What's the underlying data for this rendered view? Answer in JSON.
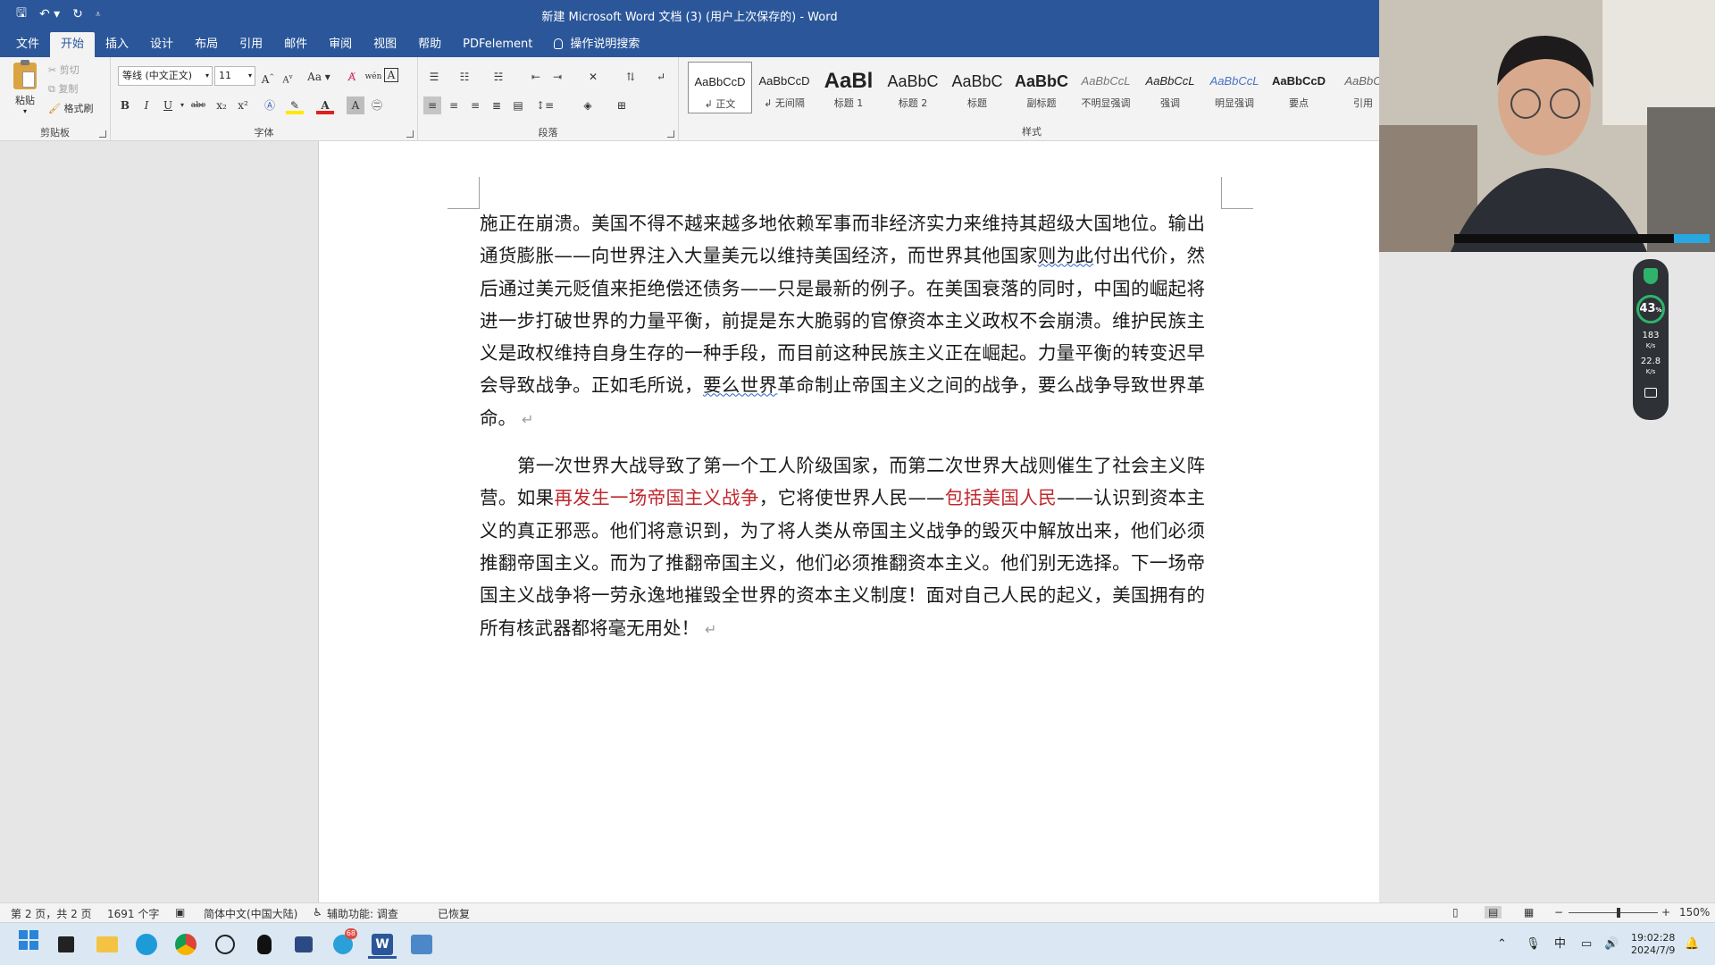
{
  "window": {
    "title": "新建 Microsoft Word 文档 (3) (用户上次保存的)  -  Word"
  },
  "tabs": [
    "文件",
    "开始",
    "插入",
    "设计",
    "布局",
    "引用",
    "邮件",
    "审阅",
    "视图",
    "帮助",
    "PDFelement",
    "操作说明搜索"
  ],
  "active_tab": "开始",
  "clipboard": {
    "paste": "粘贴",
    "cut": "剪切",
    "copy": "复制",
    "format_painter": "格式刷",
    "label": "剪贴板"
  },
  "font": {
    "name": "等线 (中文正文)",
    "size": "11",
    "grow": "A",
    "shrink": "A",
    "case": "Aa",
    "bold": "B",
    "italic": "I",
    "underline": "U",
    "strike": "abc",
    "sub": "x₂",
    "sup": "x²",
    "label": "字体"
  },
  "paragraph": {
    "label": "段落"
  },
  "styles": {
    "label": "样式",
    "items": [
      {
        "preview": "AaBbCcD",
        "name": "↲ 正文"
      },
      {
        "preview": "AaBbCcD",
        "name": "↲ 无间隔"
      },
      {
        "preview": "AaBl",
        "name": "标题 1"
      },
      {
        "preview": "AaBbC",
        "name": "标题 2"
      },
      {
        "preview": "AaBbC",
        "name": "标题"
      },
      {
        "preview": "AaBbC",
        "name": "副标题"
      },
      {
        "preview": "AaBbCcL",
        "name": "不明显强调"
      },
      {
        "preview": "AaBbCcL",
        "name": "强调"
      },
      {
        "preview": "AaBbCcL",
        "name": "明显强调"
      },
      {
        "preview": "AaBbCcD",
        "name": "要点"
      },
      {
        "preview": "AaBbC",
        "name": "引用"
      }
    ]
  },
  "document": {
    "p1": {
      "a": "施正在崩溃。美国不得不越来越多地依赖军事而非经济实力来维持其超级大国地位。输出通货膨胀——向世界注入大量美元以维持美国经济，而世界其他国家",
      "b": "则为此",
      "c": "付出代价，然后通过美元贬值来拒绝偿还债务——只是最新的例子。在美国衰落的同时，中国的崛起将进一步打破世界的力量平衡，前提是东大脆弱的官僚资本主义政权不会崩溃。维护民族主义是政权维持自身生存的一种手段，而目前这种民族主义正在崛起。力量平衡的转变迟早会导致战争。正如毛所说，",
      "d": "要么世界",
      "e": "革命制止帝国主义之间的战争，要么战争导致世界革命。"
    },
    "p2": {
      "a": "第一次世界大战导致了第一个工人阶级国家，而第二次世界大战则催生了社会主义阵营。如果",
      "b": "再发生一场帝国主义战争",
      "c": "，它将使世界人民——",
      "d": "包括美国人民",
      "e": "——认识到资本主义的真正邪恶。他们将意识到，为了将人类从帝国主义战争的毁灭中解放出来，他们必须推翻帝国主义。而为了推翻帝国主义，他们必须推翻资本主义。他们别无选择。下一场帝国主义战争将一劳永逸地摧毁全世界的资本主义制度！面对自己人民的起义，美国拥有的所有核武器都将毫无用处！"
    },
    "para_mark": "↵"
  },
  "status": {
    "page": "第 2 页，共 2 页",
    "words": "1691 个字",
    "language": "简体中文(中国大陆)",
    "accessibility": "辅助功能: 调查",
    "recovered": "已恢复",
    "zoom": "150%"
  },
  "taskbar": {
    "time": "19:02:28",
    "date": "2024/7/9",
    "ime": "中",
    "badge": "68"
  },
  "widget": {
    "percent": "43",
    "up": "183",
    "down": "22.8",
    "unit": "K/s"
  }
}
